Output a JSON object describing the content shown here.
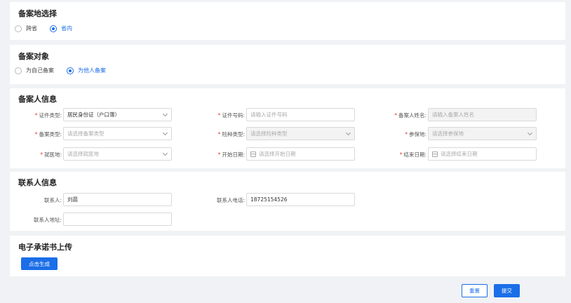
{
  "filing_location": {
    "title": "备案地选择",
    "options": [
      {
        "label": "跨省",
        "selected": false
      },
      {
        "label": "省内",
        "selected": true
      }
    ]
  },
  "filing_target": {
    "title": "备案对象",
    "options": [
      {
        "label": "为自己备案",
        "selected": false
      },
      {
        "label": "为他人备案",
        "selected": true
      }
    ]
  },
  "filer_info": {
    "title": "备案人信息",
    "id_type": {
      "label": "证件类型:",
      "value": "居民身份证（户口簿）"
    },
    "id_number": {
      "label": "证件号码:",
      "placeholder": "请输入证件号码"
    },
    "filer_name": {
      "label": "备案人姓名:",
      "placeholder": "请输入备案人姓名"
    },
    "filing_type": {
      "label": "备案类型:",
      "placeholder": "请选择备案类型"
    },
    "insurance_type": {
      "label": "险种类型:",
      "placeholder": "请选择险种类型"
    },
    "insured_place": {
      "label": "参保地:",
      "placeholder": "请选择参保地"
    },
    "medical_place": {
      "label": "就医地:",
      "placeholder": "请选择就医地"
    },
    "start_date": {
      "label": "开始日期:",
      "placeholder": "请选择开始日期"
    },
    "end_date": {
      "label": "结束日期:",
      "placeholder": "请选择结束日期"
    }
  },
  "contact_info": {
    "title": "联系人信息",
    "contact": {
      "label": "联系人:",
      "value": "刘晨"
    },
    "phone": {
      "label": "联系人电话:",
      "value": "18725154526"
    },
    "address": {
      "label": "联系人地址:",
      "value": ""
    }
  },
  "upload": {
    "title": "电子承诺书上传",
    "generate_label": "点击生成"
  },
  "footer": {
    "reset_label": "重置",
    "submit_label": "提交"
  },
  "colors": {
    "primary": "#1a6ee8",
    "required": "#e53935"
  }
}
